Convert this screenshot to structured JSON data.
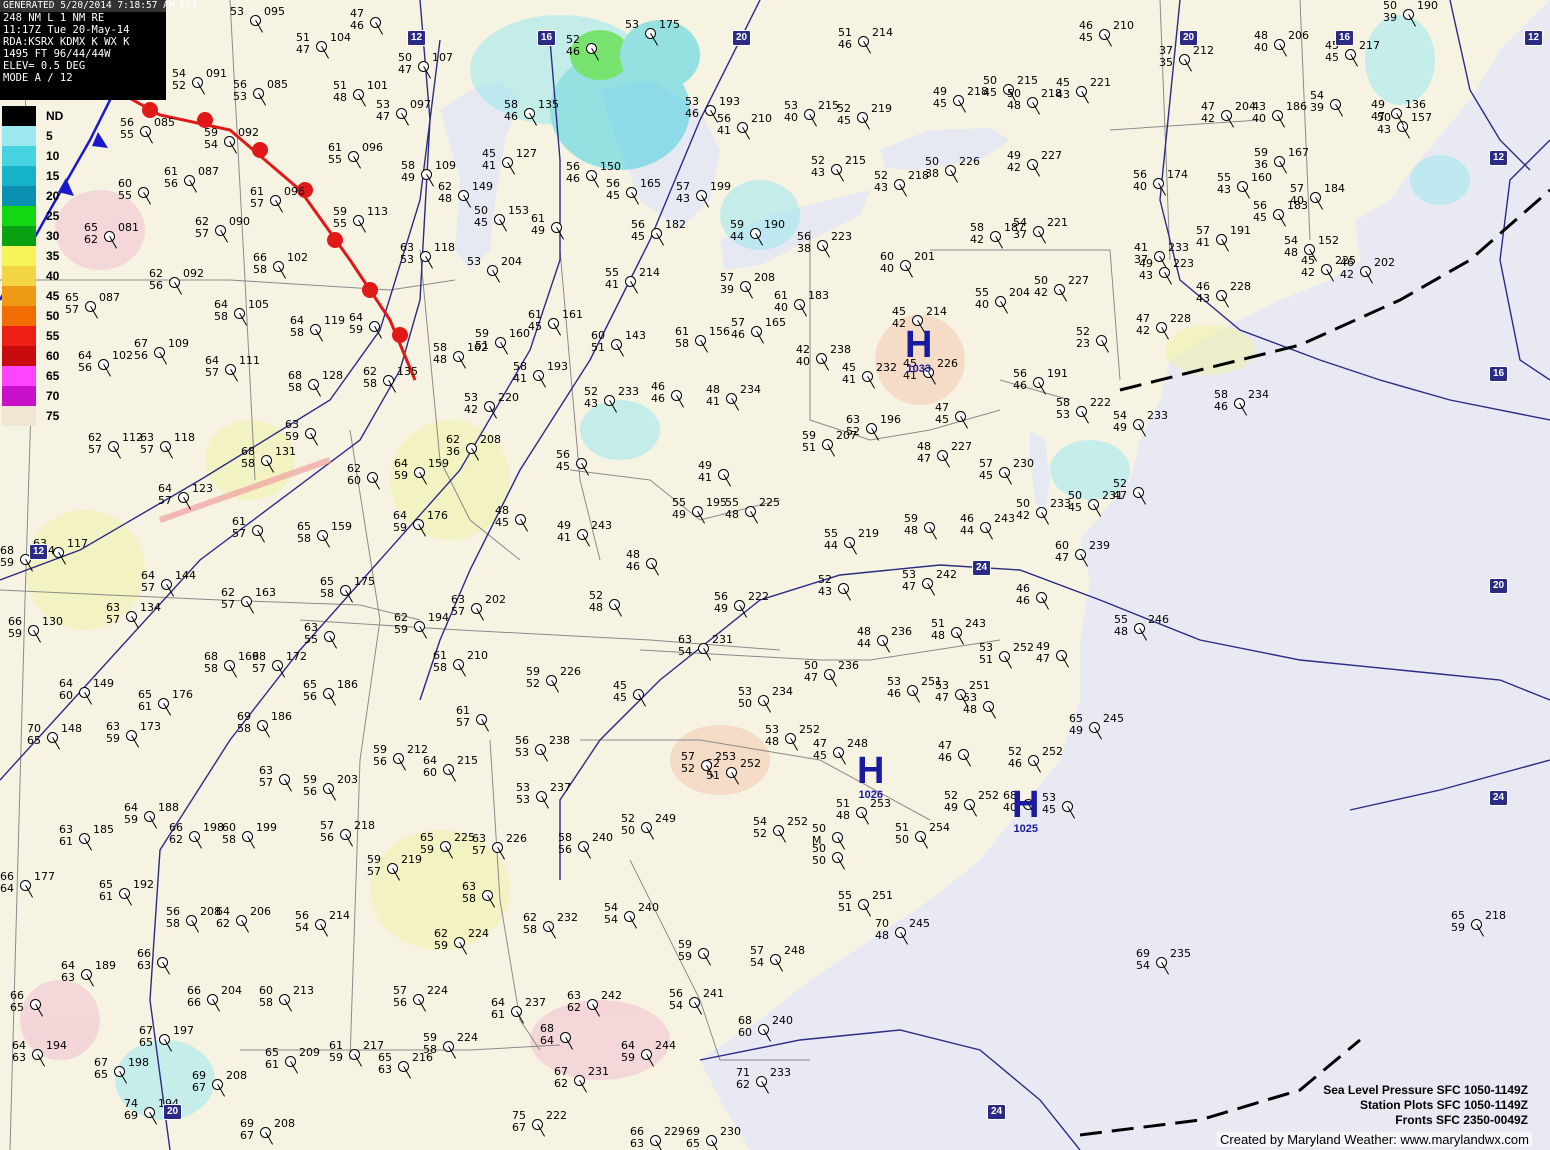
{
  "header": {
    "generated": "GENERATED 5/20/2014 7:18:57 AM EDT",
    "lines": [
      "248 NM L 1 NM RE",
      "11:17Z Tue 20-May-14",
      "RDA:KSRX KDMX K WX K",
      "1495 FT  96/44/44W",
      "ELEV= 0.5 DEG",
      "MODE A / 12"
    ]
  },
  "legend": {
    "entries": [
      {
        "label": "ND",
        "color": "#000000"
      },
      {
        "label": "5",
        "color": "#9ce8ee"
      },
      {
        "label": "10",
        "color": "#46d2e0"
      },
      {
        "label": "15",
        "color": "#16b3c8"
      },
      {
        "label": "20",
        "color": "#0b8fb0"
      },
      {
        "label": "25",
        "color": "#12d812"
      },
      {
        "label": "30",
        "color": "#0aa012"
      },
      {
        "label": "35",
        "color": "#f5f55a"
      },
      {
        "label": "40",
        "color": "#f2d444"
      },
      {
        "label": "45",
        "color": "#ee9a14"
      },
      {
        "label": "50",
        "color": "#f26c04"
      },
      {
        "label": "55",
        "color": "#ee1e14"
      },
      {
        "label": "60",
        "color": "#c80a0a"
      },
      {
        "label": "65",
        "color": "#ff44ff"
      },
      {
        "label": "70",
        "color": "#c810c8"
      },
      {
        "label": "75",
        "color": "#f0e6d2"
      }
    ]
  },
  "highs": [
    {
      "label": "H",
      "value": "1033"
    },
    {
      "label": "H",
      "value": "1026"
    },
    {
      "label": "H",
      "value": "1025"
    }
  ],
  "routes": [
    "12",
    "16",
    "20",
    "12",
    "20",
    "16",
    "12",
    "24",
    "20",
    "24",
    "20",
    "24",
    "16",
    "12"
  ],
  "stations": [
    {
      "t": "53",
      "d": "",
      "p": "095"
    },
    {
      "t": "47",
      "d": "46",
      "p": ""
    },
    {
      "t": "51",
      "d": "47",
      "p": "104"
    },
    {
      "t": "50",
      "d": "47",
      "p": "107"
    },
    {
      "t": "54",
      "d": "52",
      "p": "091"
    },
    {
      "t": "56",
      "d": "53",
      "p": "085"
    },
    {
      "t": "51",
      "d": "48",
      "p": "101"
    },
    {
      "t": "53",
      "d": "47",
      "p": "097"
    },
    {
      "t": "56",
      "d": "55",
      "p": "085"
    },
    {
      "t": "59",
      "d": "54",
      "p": "092"
    },
    {
      "t": "61",
      "d": "55",
      "p": "096"
    },
    {
      "t": "58",
      "d": "49",
      "p": "109"
    },
    {
      "t": "61",
      "d": "56",
      "p": "087"
    },
    {
      "t": "60",
      "d": "55",
      "p": ""
    },
    {
      "t": "61",
      "d": "57",
      "p": "096"
    },
    {
      "t": "59",
      "d": "55",
      "p": "113"
    },
    {
      "t": "62",
      "d": "57",
      "p": "090"
    },
    {
      "t": "65",
      "d": "62",
      "p": "081"
    },
    {
      "t": "63",
      "d": "53",
      "p": "118"
    },
    {
      "t": "66",
      "d": "58",
      "p": "102"
    },
    {
      "t": "62",
      "d": "56",
      "p": "092"
    },
    {
      "t": "65",
      "d": "57",
      "p": "087"
    },
    {
      "t": "64",
      "d": "58",
      "p": "105"
    },
    {
      "t": "64",
      "d": "58",
      "p": "119"
    },
    {
      "t": "64",
      "d": "59",
      "p": ""
    },
    {
      "t": "67",
      "d": "56",
      "p": "109"
    },
    {
      "t": "64",
      "d": "56",
      "p": "102"
    },
    {
      "t": "64",
      "d": "57",
      "p": "111"
    },
    {
      "t": "68",
      "d": "58",
      "p": "128"
    },
    {
      "t": "62",
      "d": "58",
      "p": "135"
    },
    {
      "t": "63",
      "d": "59",
      "p": ""
    },
    {
      "t": "62",
      "d": "57",
      "p": "112"
    },
    {
      "t": "63",
      "d": "57",
      "p": "118"
    },
    {
      "t": "68",
      "d": "58",
      "p": "131"
    },
    {
      "t": "62",
      "d": "60",
      "p": ""
    },
    {
      "t": "64",
      "d": "59",
      "p": "159"
    },
    {
      "t": "64",
      "d": "57",
      "p": "123"
    },
    {
      "t": "61",
      "d": "57",
      "p": ""
    },
    {
      "t": "64",
      "d": "59",
      "p": "176"
    },
    {
      "t": "65",
      "d": "58",
      "p": "159"
    },
    {
      "t": "63",
      "d": "58",
      "p": "117"
    },
    {
      "t": "68",
      "d": "59",
      "p": "104"
    },
    {
      "t": "64",
      "d": "57",
      "p": "144"
    },
    {
      "t": "65",
      "d": "58",
      "p": "175"
    },
    {
      "t": "62",
      "d": "57",
      "p": "163"
    },
    {
      "t": "63",
      "d": "57",
      "p": "134"
    },
    {
      "t": "66",
      "d": "59",
      "p": "130"
    },
    {
      "t": "63",
      "d": "55",
      "p": ""
    },
    {
      "t": "62",
      "d": "59",
      "p": "194"
    },
    {
      "t": "63",
      "d": "57",
      "p": "202"
    },
    {
      "t": "68",
      "d": "58",
      "p": "169"
    },
    {
      "t": "68",
      "d": "57",
      "p": "172"
    },
    {
      "t": "61",
      "d": "58",
      "p": "210"
    },
    {
      "t": "64",
      "d": "60",
      "p": "149"
    },
    {
      "t": "65",
      "d": "61",
      "p": "176"
    },
    {
      "t": "65",
      "d": "56",
      "p": "186"
    },
    {
      "t": "70",
      "d": "65",
      "p": "148"
    },
    {
      "t": "63",
      "d": "59",
      "p": "173"
    },
    {
      "t": "69",
      "d": "58",
      "p": "186"
    },
    {
      "t": "61",
      "d": "57",
      "p": ""
    },
    {
      "t": "59",
      "d": "52",
      "p": "226"
    },
    {
      "t": "56",
      "d": "53",
      "p": "238"
    },
    {
      "t": "59",
      "d": "56",
      "p": "212"
    },
    {
      "t": "64",
      "d": "60",
      "p": "215"
    },
    {
      "t": "63",
      "d": "57",
      "p": ""
    },
    {
      "t": "59",
      "d": "56",
      "p": "203"
    },
    {
      "t": "53",
      "d": "53",
      "p": "237"
    },
    {
      "t": "63",
      "d": "61",
      "p": "185"
    },
    {
      "t": "64",
      "d": "59",
      "p": "188"
    },
    {
      "t": "66",
      "d": "62",
      "p": "198"
    },
    {
      "t": "60",
      "d": "58",
      "p": "199"
    },
    {
      "t": "57",
      "d": "56",
      "p": "218"
    },
    {
      "t": "65",
      "d": "59",
      "p": "225"
    },
    {
      "t": "63",
      "d": "57",
      "p": "226"
    },
    {
      "t": "58",
      "d": "56",
      "p": "240"
    },
    {
      "t": "59",
      "d": "57",
      "p": "219"
    },
    {
      "t": "63",
      "d": "58",
      "p": ""
    },
    {
      "t": "65",
      "d": "61",
      "p": "192"
    },
    {
      "t": "66",
      "d": "64",
      "p": "177"
    },
    {
      "t": "56",
      "d": "58",
      "p": "208"
    },
    {
      "t": "64",
      "d": "62",
      "p": "206"
    },
    {
      "t": "56",
      "d": "54",
      "p": "214"
    },
    {
      "t": "62",
      "d": "59",
      "p": "224"
    },
    {
      "t": "62",
      "d": "58",
      "p": "232"
    },
    {
      "t": "54",
      "d": "54",
      "p": "240"
    },
    {
      "t": "66",
      "d": "63",
      "p": ""
    },
    {
      "t": "64",
      "d": "63",
      "p": "189"
    },
    {
      "t": "66",
      "d": "66",
      "p": "204"
    },
    {
      "t": "60",
      "d": "58",
      "p": "213"
    },
    {
      "t": "57",
      "d": "56",
      "p": "224"
    },
    {
      "t": "63",
      "d": "62",
      "p": "242"
    },
    {
      "t": "66",
      "d": "65",
      "p": ""
    },
    {
      "t": "64",
      "d": "61",
      "p": "237"
    },
    {
      "t": "68",
      "d": "64",
      "p": ""
    },
    {
      "t": "64",
      "d": "59",
      "p": "244"
    },
    {
      "t": "56",
      "d": "54",
      "p": "241"
    },
    {
      "t": "67",
      "d": "65",
      "p": "197"
    },
    {
      "t": "61",
      "d": "59",
      "p": "217"
    },
    {
      "t": "59",
      "d": "58",
      "p": "224"
    },
    {
      "t": "64",
      "d": "63",
      "p": "194"
    },
    {
      "t": "67",
      "d": "65",
      "p": "198"
    },
    {
      "t": "69",
      "d": "67",
      "p": "208"
    },
    {
      "t": "65",
      "d": "61",
      "p": "209"
    },
    {
      "t": "65",
      "d": "63",
      "p": "216"
    },
    {
      "t": "67",
      "d": "62",
      "p": "231"
    },
    {
      "t": "74",
      "d": "69",
      "p": "194"
    },
    {
      "t": "69",
      "d": "67",
      "p": "208"
    },
    {
      "t": "75",
      "d": "67",
      "p": "222"
    },
    {
      "t": "71",
      "d": "62",
      "p": "233"
    },
    {
      "t": "66",
      "d": "63",
      "p": "229"
    },
    {
      "t": "69",
      "d": "65",
      "p": "230"
    },
    {
      "t": "68",
      "d": "60",
      "p": "240"
    },
    {
      "t": "57",
      "d": "54",
      "p": "248"
    },
    {
      "t": "59",
      "d": "59",
      "p": ""
    },
    {
      "t": "55",
      "d": "51",
      "p": "251"
    },
    {
      "t": "50",
      "d": "50",
      "p": ""
    },
    {
      "t": "50",
      "d": "M",
      "p": ""
    },
    {
      "t": "51",
      "d": "50",
      "p": "254"
    },
    {
      "t": "70",
      "d": "48",
      "p": "245"
    },
    {
      "t": "69",
      "d": "54",
      "p": "235"
    },
    {
      "t": "65",
      "d": "59",
      "p": "218"
    },
    {
      "t": "52",
      "d": "51",
      "p": "252"
    },
    {
      "t": "52",
      "d": "50",
      "p": "249"
    },
    {
      "t": "54",
      "d": "52",
      "p": "252"
    },
    {
      "t": "51",
      "d": "48",
      "p": "253"
    },
    {
      "t": "52",
      "d": "49",
      "p": "252"
    },
    {
      "t": "68",
      "d": "40",
      "p": ""
    },
    {
      "t": "53",
      "d": "45",
      "p": ""
    },
    {
      "t": "52",
      "d": "46",
      "p": "252"
    },
    {
      "t": "65",
      "d": "49",
      "p": "245"
    },
    {
      "t": "57",
      "d": "52",
      "p": "253"
    },
    {
      "t": "53",
      "d": "48",
      "p": "252"
    },
    {
      "t": "47",
      "d": "45",
      "p": "248"
    },
    {
      "t": "47",
      "d": "46",
      "p": ""
    },
    {
      "t": "53",
      "d": "48",
      "p": ""
    },
    {
      "t": "45",
      "d": "45",
      "p": ""
    },
    {
      "t": "53",
      "d": "50",
      "p": "234"
    },
    {
      "t": "50",
      "d": "47",
      "p": "236"
    },
    {
      "t": "53",
      "d": "46",
      "p": "251"
    },
    {
      "t": "53",
      "d": "47",
      "p": "251"
    },
    {
      "t": "53",
      "d": "51",
      "p": "252"
    },
    {
      "t": "49",
      "d": "47",
      "p": ""
    },
    {
      "t": "55",
      "d": "48",
      "p": "246"
    },
    {
      "t": "63",
      "d": "54",
      "p": "231"
    },
    {
      "t": "48",
      "d": "44",
      "p": "236"
    },
    {
      "t": "51",
      "d": "48",
      "p": "243"
    },
    {
      "t": "52",
      "d": "48",
      "p": ""
    },
    {
      "t": "56",
      "d": "49",
      "p": "222"
    },
    {
      "t": "52",
      "d": "43",
      "p": ""
    },
    {
      "t": "53",
      "d": "47",
      "p": "242"
    },
    {
      "t": "46",
      "d": "46",
      "p": ""
    },
    {
      "t": "60",
      "d": "47",
      "p": "239"
    },
    {
      "t": "59",
      "d": "48",
      "p": ""
    },
    {
      "t": "46",
      "d": "44",
      "p": "243"
    },
    {
      "t": "50",
      "d": "42",
      "p": "233"
    },
    {
      "t": "50",
      "d": "45",
      "p": "231"
    },
    {
      "t": "52",
      "d": "47",
      "p": ""
    },
    {
      "t": "57",
      "d": "45",
      "p": "230"
    },
    {
      "t": "54",
      "d": "49",
      "p": "233"
    },
    {
      "t": "58",
      "d": "53",
      "p": "222"
    },
    {
      "t": "58",
      "d": "46",
      "p": "234"
    },
    {
      "t": "55",
      "d": "44",
      "p": "219"
    },
    {
      "t": "55",
      "d": "48",
      "p": "225"
    },
    {
      "t": "55",
      "d": "49",
      "p": "195"
    },
    {
      "t": "49",
      "d": "41",
      "p": ""
    },
    {
      "t": "48",
      "d": "47",
      "p": "227"
    },
    {
      "t": "47",
      "d": "45",
      "p": ""
    },
    {
      "t": "48",
      "d": "46",
      "p": ""
    },
    {
      "t": "49",
      "d": "41",
      "p": "243"
    },
    {
      "t": "48",
      "d": "45",
      "p": ""
    },
    {
      "t": "56",
      "d": "45",
      "p": ""
    },
    {
      "t": "59",
      "d": "51",
      "p": "207"
    },
    {
      "t": "63",
      "d": "52",
      "p": "196"
    },
    {
      "t": "56",
      "d": "46",
      "p": "191"
    },
    {
      "t": "47",
      "d": "42",
      "p": "228"
    },
    {
      "t": "52",
      "d": "23",
      "p": ""
    },
    {
      "t": "49",
      "d": "43",
      "p": "223"
    },
    {
      "t": "50",
      "d": "42",
      "p": "227"
    },
    {
      "t": "55",
      "d": "40",
      "p": "204"
    },
    {
      "t": "45",
      "d": "42",
      "p": "214"
    },
    {
      "t": "45",
      "d": "41",
      "p": "226"
    },
    {
      "t": "45",
      "d": "41",
      "p": "232"
    },
    {
      "t": "42",
      "d": "40",
      "p": "238"
    },
    {
      "t": "48",
      "d": "41",
      "p": "234"
    },
    {
      "t": "46",
      "d": "46",
      "p": ""
    },
    {
      "t": "52",
      "d": "43",
      "p": "233"
    },
    {
      "t": "53",
      "d": "42",
      "p": "220"
    },
    {
      "t": "62",
      "d": "36",
      "p": "208"
    },
    {
      "t": "58",
      "d": "41",
      "p": "193"
    },
    {
      "t": "58",
      "d": "48",
      "p": "162"
    },
    {
      "t": "59",
      "d": "51",
      "p": "160"
    },
    {
      "t": "61",
      "d": "45",
      "p": "161"
    },
    {
      "t": "60",
      "d": "51",
      "p": "143"
    },
    {
      "t": "61",
      "d": "58",
      "p": "156"
    },
    {
      "t": "57",
      "d": "46",
      "p": "165"
    },
    {
      "t": "61",
      "d": "40",
      "p": "183"
    },
    {
      "t": "57",
      "d": "39",
      "p": "208"
    },
    {
      "t": "55",
      "d": "41",
      "p": "214"
    },
    {
      "t": "56",
      "d": "38",
      "p": "223"
    },
    {
      "t": "60",
      "d": "40",
      "p": "201"
    },
    {
      "t": "58",
      "d": "42",
      "p": "187"
    },
    {
      "t": "54",
      "d": "37",
      "p": "221"
    },
    {
      "t": "41",
      "d": "37",
      "p": "233"
    },
    {
      "t": "46",
      "d": "43",
      "p": "228"
    },
    {
      "t": "45",
      "d": "42",
      "p": "225"
    },
    {
      "t": "46",
      "d": "42",
      "p": "202"
    },
    {
      "t": "57",
      "d": "41",
      "p": "191"
    },
    {
      "t": "56",
      "d": "45",
      "p": "183"
    },
    {
      "t": "54",
      "d": "48",
      "p": "152"
    },
    {
      "t": "57",
      "d": "40",
      "p": "184"
    },
    {
      "t": "59",
      "d": "36",
      "p": "167"
    },
    {
      "t": "55",
      "d": "43",
      "p": "160"
    },
    {
      "t": "56",
      "d": "40",
      "p": "174"
    },
    {
      "t": "47",
      "d": "42",
      "p": "204"
    },
    {
      "t": "43",
      "d": "40",
      "p": "186"
    },
    {
      "t": "54",
      "d": "39",
      "p": ""
    },
    {
      "t": "50",
      "d": "43",
      "p": "157"
    },
    {
      "t": "49",
      "d": "47",
      "p": "136"
    },
    {
      "t": "53",
      "d": "46",
      "p": "193"
    },
    {
      "t": "56",
      "d": "41",
      "p": "210"
    },
    {
      "t": "53",
      "d": "40",
      "p": "215"
    },
    {
      "t": "52",
      "d": "45",
      "p": "219"
    },
    {
      "t": "52",
      "d": "43",
      "p": "215"
    },
    {
      "t": "52",
      "d": "43",
      "p": "218"
    },
    {
      "t": "50",
      "d": "38",
      "p": "226"
    },
    {
      "t": "49",
      "d": "42",
      "p": "227"
    },
    {
      "t": "49",
      "d": "45",
      "p": "218"
    },
    {
      "t": "50",
      "d": "45",
      "p": "215"
    },
    {
      "t": "50",
      "d": "48",
      "p": "218"
    },
    {
      "t": "51",
      "d": "46",
      "p": "214"
    },
    {
      "t": "45",
      "d": "43",
      "p": "221"
    },
    {
      "t": "46",
      "d": "45",
      "p": "210"
    },
    {
      "t": "37",
      "d": "35",
      "p": "212"
    },
    {
      "t": "48",
      "d": "40",
      "p": "206"
    },
    {
      "t": "45",
      "d": "45",
      "p": "217"
    },
    {
      "t": "50",
      "d": "39",
      "p": "190"
    },
    {
      "t": "50",
      "d": "45",
      "p": "153"
    },
    {
      "t": "61",
      "d": "49",
      "p": ""
    },
    {
      "t": "56",
      "d": "46",
      "p": "150"
    },
    {
      "t": "56",
      "d": "45",
      "p": "165"
    },
    {
      "t": "56",
      "d": "45",
      "p": "182"
    },
    {
      "t": "59",
      "d": "44",
      "p": "190"
    },
    {
      "t": "57",
      "d": "43",
      "p": "199"
    },
    {
      "t": "53",
      "d": "",
      "p": "204"
    },
    {
      "t": "62",
      "d": "48",
      "p": "149"
    },
    {
      "t": "45",
      "d": "41",
      "p": "127"
    },
    {
      "t": "58",
      "d": "46",
      "p": "135"
    },
    {
      "t": "52",
      "d": "46",
      "p": ""
    },
    {
      "t": "53",
      "d": "",
      "p": "175"
    },
    {
      "t": "48",
      "d": "",
      "p": "182"
    }
  ],
  "footer": {
    "lines": [
      "Sea Level Pressure SFC 1050-1149Z",
      "Station Plots SFC 1050-1149Z",
      "Fronts SFC 2350-0049Z"
    ],
    "credit": "Created by Maryland Weather: www.marylandwx.com"
  }
}
